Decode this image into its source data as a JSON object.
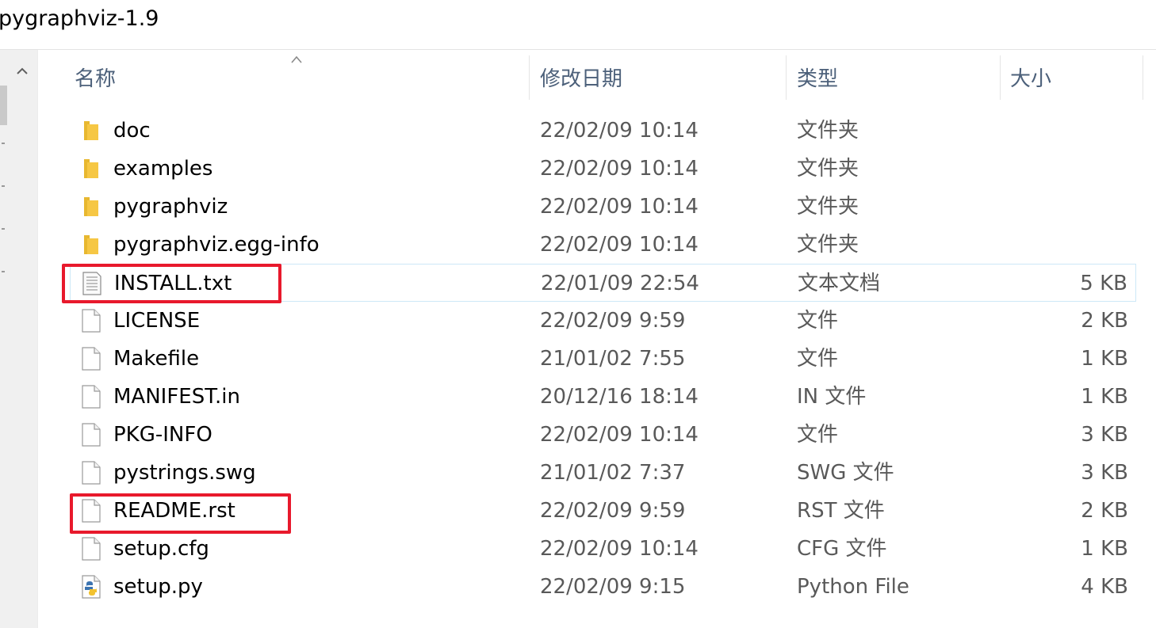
{
  "window": {
    "title": "pygraphviz-1.9"
  },
  "columns": {
    "name": "名称",
    "date": "修改日期",
    "type": "类型",
    "size": "大小"
  },
  "files": [
    {
      "name": "doc",
      "date": "22/02/09 10:14",
      "type": "文件夹",
      "size": "",
      "icon": "folder-icon"
    },
    {
      "name": "examples",
      "date": "22/02/09 10:14",
      "type": "文件夹",
      "size": "",
      "icon": "folder-icon"
    },
    {
      "name": "pygraphviz",
      "date": "22/02/09 10:14",
      "type": "文件夹",
      "size": "",
      "icon": "folder-icon"
    },
    {
      "name": "pygraphviz.egg-info",
      "date": "22/02/09 10:14",
      "type": "文件夹",
      "size": "",
      "icon": "folder-icon"
    },
    {
      "name": "INSTALL.txt",
      "date": "22/01/09 22:54",
      "type": "文本文档",
      "size": "5 KB",
      "icon": "text-document-icon"
    },
    {
      "name": "LICENSE",
      "date": "22/02/09 9:59",
      "type": "文件",
      "size": "2 KB",
      "icon": "file-icon"
    },
    {
      "name": "Makefile",
      "date": "21/01/02 7:55",
      "type": "文件",
      "size": "1 KB",
      "icon": "file-icon"
    },
    {
      "name": "MANIFEST.in",
      "date": "20/12/16 18:14",
      "type": "IN 文件",
      "size": "1 KB",
      "icon": "file-icon"
    },
    {
      "name": "PKG-INFO",
      "date": "22/02/09 10:14",
      "type": "文件",
      "size": "3 KB",
      "icon": "file-icon"
    },
    {
      "name": "pystrings.swg",
      "date": "21/01/02 7:37",
      "type": "SWG 文件",
      "size": "3 KB",
      "icon": "file-icon"
    },
    {
      "name": "README.rst",
      "date": "22/02/09 9:59",
      "type": "RST 文件",
      "size": "2 KB",
      "icon": "file-icon"
    },
    {
      "name": "setup.cfg",
      "date": "22/02/09 10:14",
      "type": "CFG 文件",
      "size": "1 KB",
      "icon": "file-icon"
    },
    {
      "name": "setup.py",
      "date": "22/02/09 9:15",
      "type": "Python File",
      "size": "4 KB",
      "icon": "python-file-icon"
    }
  ],
  "selected_file": "INSTALL.txt",
  "highlighted_files": [
    "INSTALL.txt",
    "README.rst"
  ],
  "colors": {
    "header_text": "#4c607a",
    "highlight_box": "#e8192c",
    "selection_border": "#cde8f7",
    "folder": "#f6c744"
  },
  "icons": {
    "scroll_up": "chevron-up-icon",
    "sort": "sort-ascending-icon"
  }
}
